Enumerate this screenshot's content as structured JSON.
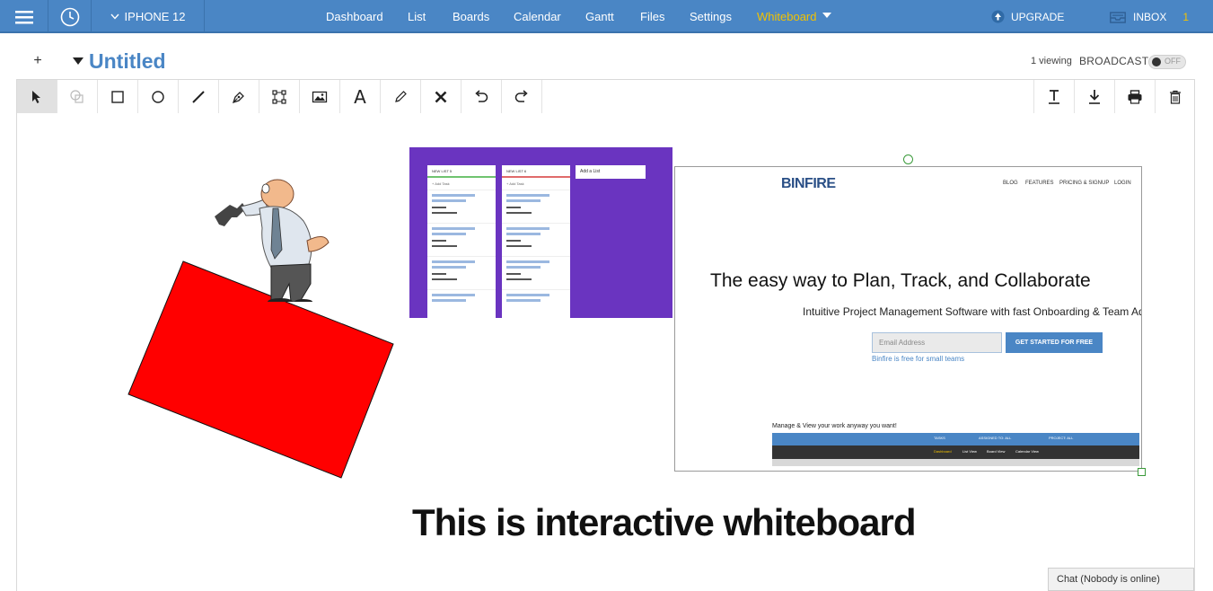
{
  "topbar": {
    "device": "IPHONE 12",
    "nav": [
      "Dashboard",
      "List",
      "Boards",
      "Calendar",
      "Gantt",
      "Files",
      "Settings",
      "Whiteboard"
    ],
    "active_nav": "Whiteboard",
    "upgrade": "UPGRADE",
    "inbox": "INBOX",
    "inbox_count": "1"
  },
  "board": {
    "add": "+",
    "title": "Untitled",
    "viewing": "1 viewing",
    "broadcast": "BROADCAST",
    "broadcast_state": "OFF"
  },
  "toolbar": {
    "tools": [
      "select-tool",
      "group-tool",
      "rectangle-tool",
      "circle-tool",
      "line-tool",
      "pen-tool",
      "crop-tool",
      "image-tool",
      "text-tool",
      "highlighter-tool",
      "delete-tool",
      "undo-tool",
      "redo-tool"
    ],
    "right_tools": [
      "text-format-tool",
      "download-tool",
      "print-tool",
      "trash-tool"
    ],
    "text_tool_label": "A"
  },
  "canvas": {
    "kanban": {
      "col1": "NEW LIST 5",
      "col2": "NEW LIST 6",
      "add_task": "+ Add Task",
      "add_list": "Add a List"
    },
    "site": {
      "logo": "BINFIRE",
      "nav": [
        "BLOG",
        "FEATURES",
        "PRICING & SIGNUP",
        "LOGIN"
      ],
      "headline": "The easy way to Plan, Track, and Collaborate",
      "subheadline": "Intuitive Project Management Software with fast Onboarding & Team Ad",
      "email_placeholder": "Email Address",
      "cta": "GET STARTED FOR FREE",
      "free_note": "Binfire is free for small teams",
      "manage": "Manage & View your work anyway you want!",
      "appbar": [
        "TASKS",
        "ASSIGNED TO: ALL",
        "PROJECT: ALL"
      ],
      "subbar": [
        "Dashboard",
        "List View",
        "Board View",
        "Calendar View"
      ]
    },
    "text": "This is interactive whiteboard"
  },
  "chat": "Chat (Nobody is online)",
  "colors": {
    "brand": "#4a86c5",
    "accent": "#f2c200",
    "shape_fill": "#ff0000",
    "kanban_bg": "#6a34c0"
  }
}
